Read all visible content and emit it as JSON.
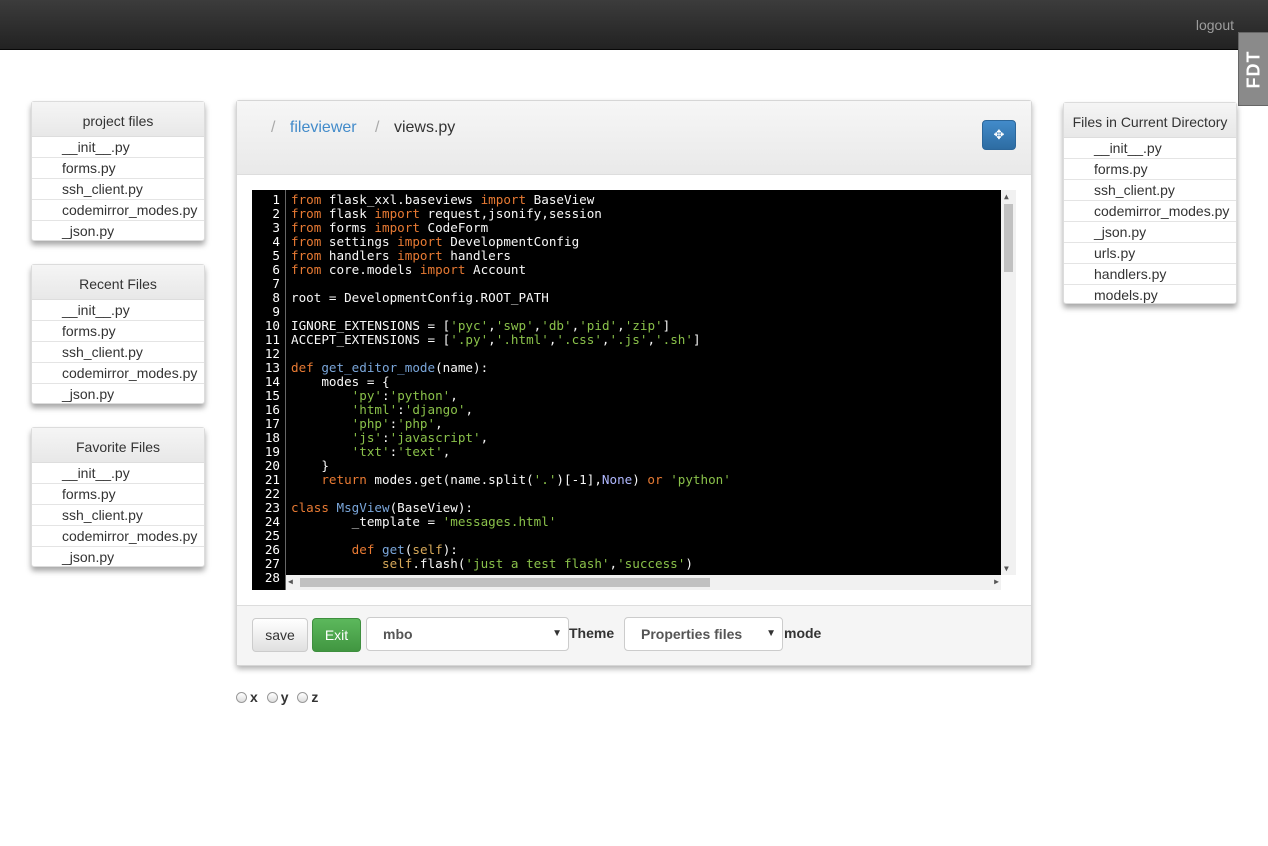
{
  "nav": {
    "logout": "logout",
    "badge": "FDT"
  },
  "project_files": {
    "title": "project files",
    "items": [
      "__init__.py",
      "forms.py",
      "ssh_client.py",
      "codemirror_modes.py",
      "_json.py"
    ]
  },
  "recent_files": {
    "title": "Recent Files",
    "items": [
      "__init__.py",
      "forms.py",
      "ssh_client.py",
      "codemirror_modes.py",
      "_json.py"
    ]
  },
  "favorite_files": {
    "title": "Favorite Files",
    "items": [
      "__init__.py",
      "forms.py",
      "ssh_client.py",
      "codemirror_modes.py",
      "_json.py"
    ]
  },
  "current_dir": {
    "title": "Files in Current Directory",
    "items": [
      "__init__.py",
      "forms.py",
      "ssh_client.py",
      "codemirror_modes.py",
      "_json.py",
      "urls.py",
      "handlers.py",
      "models.py"
    ]
  },
  "breadcrumb": {
    "sep": "/",
    "folder": "fileviewer",
    "file": "views.py"
  },
  "editor": {
    "line_numbers": [
      "1",
      "2",
      "3",
      "4",
      "5",
      "6",
      "7",
      "8",
      "9",
      "10",
      "11",
      "12",
      "13",
      "14",
      "15",
      "16",
      "17",
      "18",
      "19",
      "20",
      "21",
      "22",
      "23",
      "24",
      "25",
      "26",
      "27",
      "28"
    ],
    "lines": [
      "from flask_xxl.baseviews import BaseView",
      "from flask import request,jsonify,session",
      "from forms import CodeForm",
      "from settings import DevelopmentConfig",
      "from handlers import handlers",
      "from core.models import Account",
      "",
      "root = DevelopmentConfig.ROOT_PATH",
      "",
      "IGNORE_EXTENSIONS = ['pyc','swp','db','pid','zip']",
      "ACCEPT_EXTENSIONS = ['.py','.html','.css','.js','.sh']",
      "",
      "def get_editor_mode(name):",
      "    modes = {",
      "        'py':'python',",
      "        'html':'django',",
      "        'php':'php',",
      "        'js':'javascript',",
      "        'txt':'text',",
      "    }",
      "    return modes.get(name.split('.')[-1],None) or 'python'",
      "",
      "class MsgView(BaseView):",
      "        _template = 'messages.html'",
      "",
      "        def get(self):",
      "            self.flash('just a test flash','success')",
      ""
    ]
  },
  "toolbar": {
    "save": "save",
    "exit": "Exit",
    "theme_value": "mbo",
    "theme_label": "Theme",
    "mode_value": "Properties files",
    "mode_label": "mode"
  },
  "radios": [
    "x",
    "y",
    "z"
  ],
  "colors": {
    "primary": "#428bca",
    "success": "#5cb85c",
    "navbar": "#222222"
  }
}
